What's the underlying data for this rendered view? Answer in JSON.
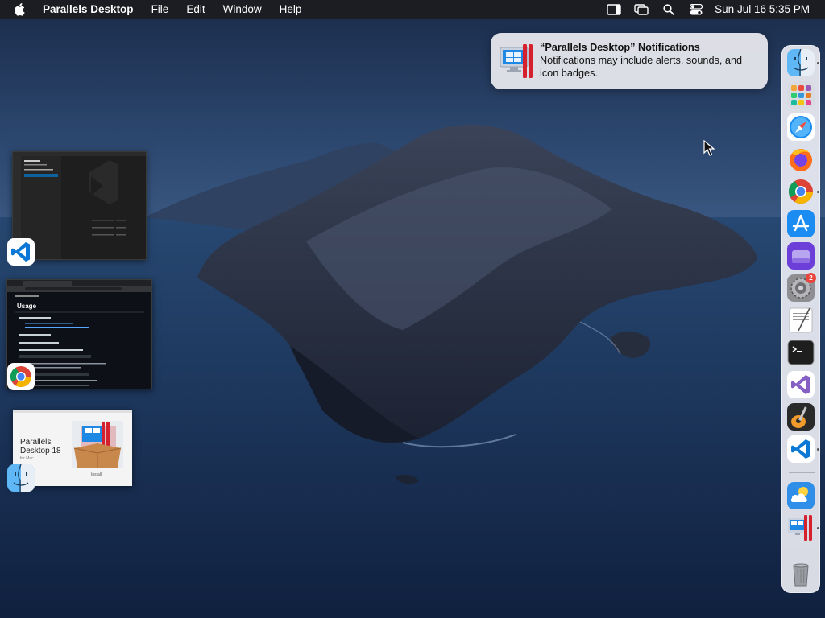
{
  "menubar": {
    "app_name": "Parallels Desktop",
    "menus": [
      "File",
      "Edit",
      "Window",
      "Help"
    ],
    "status_icons": [
      "sidebar-icon",
      "screen-mirroring-icon",
      "spotlight-search-icon",
      "control-center-icon"
    ],
    "clock": "Sun Jul 16  5:35 PM"
  },
  "notification": {
    "title": "“Parallels Desktop” Notifications",
    "body": "Notifications may include alerts, sounds, and icon badges."
  },
  "thumbnails": {
    "chrome_heading": "Usage",
    "parallels_title_1": "Parallels",
    "parallels_title_2": "Desktop 18",
    "parallels_sub": "for Mac",
    "parallels_box_label": "Install"
  },
  "dock": {
    "items": [
      "finder-icon",
      "launchpad-icon",
      "safari-icon",
      "firefox-icon",
      "chrome-icon",
      "app-store-icon",
      "disk-utility-icon",
      "system-settings-icon",
      "textedit-icon",
      "terminal-icon",
      "visual-studio-icon",
      "garageband-icon",
      "vscode-icon",
      "weather-icon",
      "parallels-icon",
      "trash-icon"
    ],
    "system_settings_badge": "2"
  },
  "colors": {
    "menubar_bg": "#1c1c1e",
    "dock_bg": "#f5f5fa",
    "badge": "#e8453c",
    "vscode_blue": "#0a78d4"
  }
}
